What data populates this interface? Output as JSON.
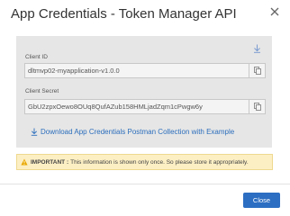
{
  "dialog": {
    "title": "App Credentials - Token Manager API",
    "close_label": "Close"
  },
  "credentials": {
    "client_id_label": "Client ID",
    "client_id_value": "dltmvp02-myapplication-v1.0.0",
    "client_secret_label": "Client Secret",
    "client_secret_value": "GbU2zpxOewo8OUq8QufAZub158HMLjadZqm1cPwgw6y",
    "download_link": "Download App Credentials Postman Collection with Example"
  },
  "notice": {
    "label": "IMPORTANT :",
    "message": "This information is shown only once. So please store it appropriately."
  },
  "colors": {
    "accent": "#2c6ec2",
    "warning_bg": "#fcefc4",
    "card_bg": "#e6e6e6"
  },
  "icons": [
    "close-icon",
    "download-icon",
    "copy-icon",
    "warning-icon"
  ]
}
